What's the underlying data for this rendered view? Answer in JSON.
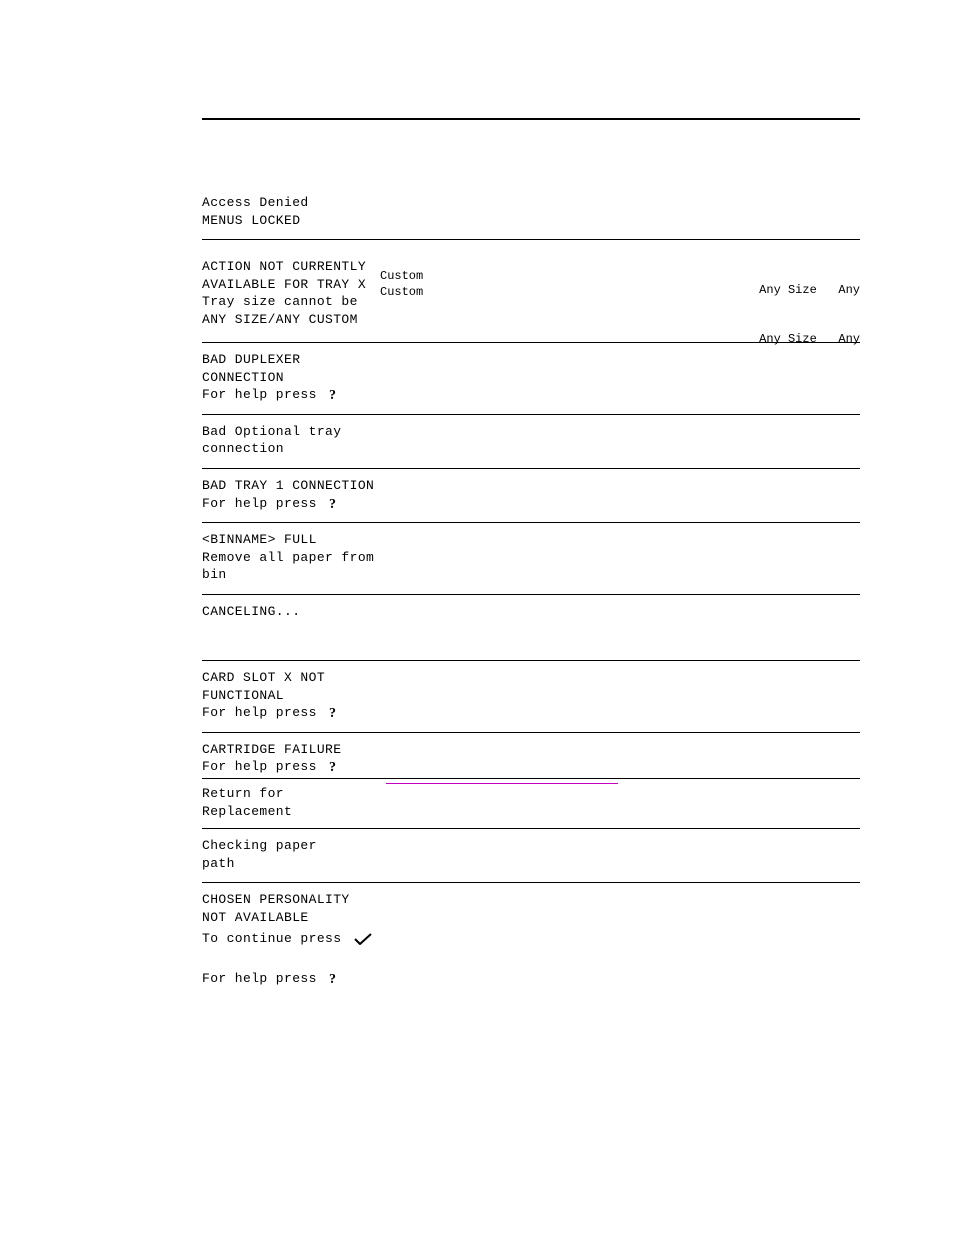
{
  "rows": {
    "r0": {
      "line1": "Access Denied",
      "line2": "MENUS LOCKED"
    },
    "r1": {
      "line1": "ACTION NOT CURRENTLY",
      "line2": "AVAILABLE FOR TRAY X",
      "line3": "Tray size cannot be",
      "line4": "ANY SIZE/ANY CUSTOM",
      "col2a": "Custom",
      "col2b": "Custom",
      "right1": "Any Size   Any",
      "right2": "Any Size   Any"
    },
    "r2": {
      "line1": "BAD DUPLEXER",
      "line2": "CONNECTION",
      "help": "For help press"
    },
    "r3": {
      "line1": "Bad Optional tray",
      "line2": "connection"
    },
    "r4": {
      "line1": "BAD TRAY 1 CONNECTION",
      "help": "For help press"
    },
    "r5": {
      "line1": "<BINNAME> FULL",
      "line2": "Remove all paper from",
      "line3": "bin"
    },
    "r6": {
      "line1": "CANCELING..."
    },
    "r7": {
      "line1": "CARD SLOT X NOT",
      "line2": "FUNCTIONAL",
      "help": "For help press"
    },
    "r8": {
      "line1": "CARTRIDGE FAILURE",
      "help": "For help press",
      "line2": "Return for",
      "line3": "Replacement"
    },
    "r9": {
      "line1": "Checking paper",
      "line2": "path"
    },
    "r10": {
      "line1": "CHOSEN PERSONALITY",
      "line2": "NOT AVAILABLE",
      "continue": "To continue press",
      "help": "For help press"
    }
  },
  "icons": {
    "help": "question-mark-icon",
    "continue": "check-mark-icon"
  }
}
